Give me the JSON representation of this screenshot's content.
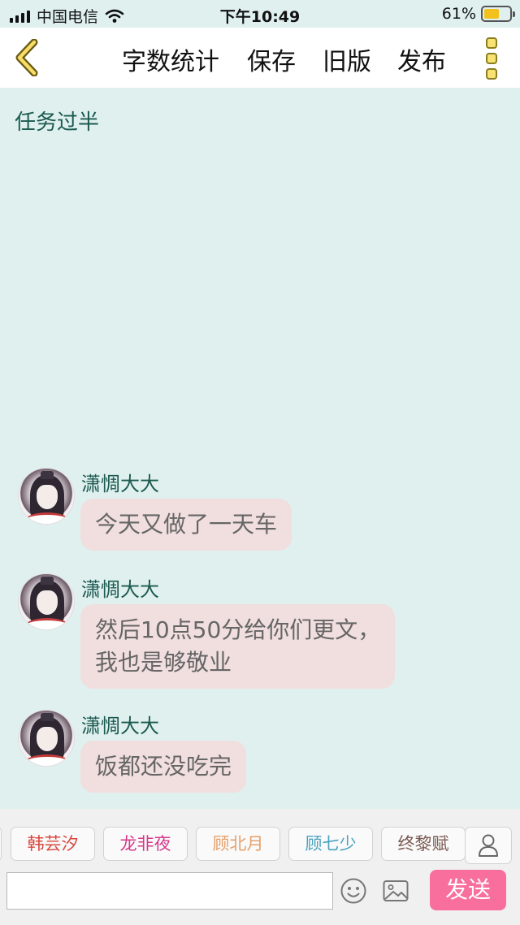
{
  "status_bar": {
    "carrier": "中国电信",
    "time": "下午10:49",
    "battery_text": "61%",
    "battery_level": 0.61
  },
  "toolbar": {
    "back_icon": "chevron-left-icon",
    "word_count": "字数统计",
    "save": "保存",
    "old_version": "旧版",
    "publish": "发布",
    "more_icon": "more-vertical-icon"
  },
  "chat": {
    "chapter_title": "任务过半",
    "messages": [
      {
        "sender": "潇惆大大",
        "lines": [
          "今天又做了一天车"
        ]
      },
      {
        "sender": "潇惆大大",
        "lines": [
          "然后10点50分给你们更文，",
          "我也是够敬业"
        ]
      },
      {
        "sender": "潇惆大大",
        "lines": [
          "饭都还没吃完"
        ]
      }
    ]
  },
  "characters": [
    {
      "name": "韩芸汐",
      "color": "#d9473f"
    },
    {
      "name": "龙非夜",
      "color": "#d6398a"
    },
    {
      "name": "顾北月",
      "color": "#e6a06a"
    },
    {
      "name": "顾七少",
      "color": "#4aa3c0"
    },
    {
      "name": "终黎赋",
      "color": "#7a5a52"
    }
  ],
  "composer": {
    "placeholder": "",
    "send_label": "发送"
  },
  "colors": {
    "background": "#dff0ef",
    "bubble": "#f1dede",
    "accent_send": "#f86e9d",
    "name_text": "#1c5a50"
  }
}
